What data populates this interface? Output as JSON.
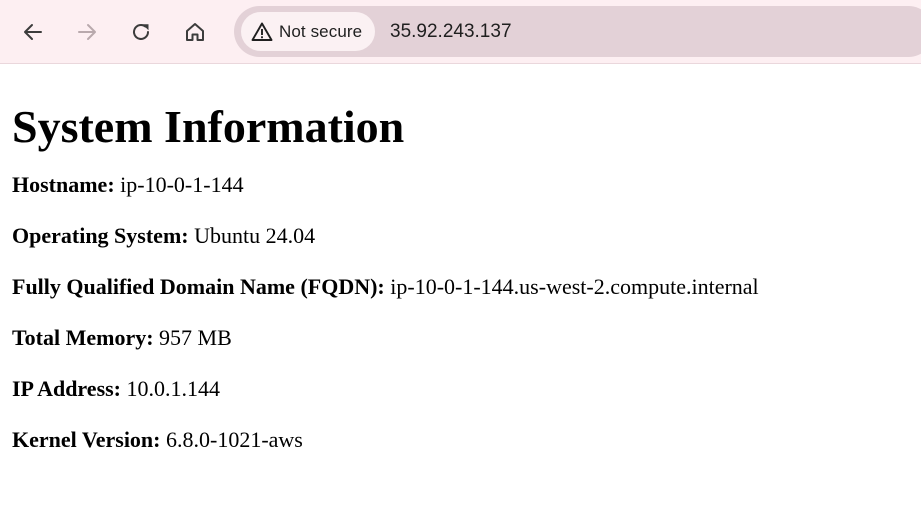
{
  "browser": {
    "security_label": "Not secure",
    "url": "35.92.243.137"
  },
  "page": {
    "title": "System Information",
    "fields": [
      {
        "label": "Hostname:",
        "value": "ip-10-0-1-144"
      },
      {
        "label": "Operating System:",
        "value": "Ubuntu 24.04"
      },
      {
        "label": "Fully Qualified Domain Name (FQDN):",
        "value": "ip-10-0-1-144.us-west-2.compute.internal"
      },
      {
        "label": "Total Memory:",
        "value": "957 MB"
      },
      {
        "label": "IP Address:",
        "value": "10.0.1.144"
      },
      {
        "label": "Kernel Version:",
        "value": "6.8.0-1021-aws"
      }
    ]
  },
  "colors": {
    "toolbar_bg": "#fdeff2",
    "omnibox_bg": "#e3d1d7",
    "chip_bg": "#fbf1f3"
  }
}
